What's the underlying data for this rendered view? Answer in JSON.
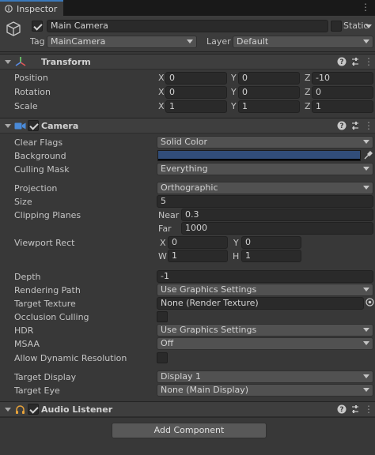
{
  "tab": {
    "label": "Inspector"
  },
  "object": {
    "name": "Main Camera",
    "static_label": "Static",
    "tag_label": "Tag",
    "tag_value": "MainCamera",
    "layer_label": "Layer",
    "layer_value": "Default"
  },
  "transform": {
    "title": "Transform",
    "position_label": "Position",
    "rotation_label": "Rotation",
    "scale_label": "Scale",
    "axes": {
      "x": "X",
      "y": "Y",
      "z": "Z"
    },
    "position": {
      "x": "0",
      "y": "0",
      "z": "-10"
    },
    "rotation": {
      "x": "0",
      "y": "0",
      "z": "0"
    },
    "scale": {
      "x": "1",
      "y": "1",
      "z": "1"
    }
  },
  "camera": {
    "title": "Camera",
    "clear_flags_label": "Clear Flags",
    "clear_flags_value": "Solid Color",
    "background_label": "Background",
    "background_color": "#314d79",
    "culling_mask_label": "Culling Mask",
    "culling_mask_value": "Everything",
    "projection_label": "Projection",
    "projection_value": "Orthographic",
    "size_label": "Size",
    "size_value": "5",
    "clipping_label": "Clipping Planes",
    "near_label": "Near",
    "near_value": "0.3",
    "far_label": "Far",
    "far_value": "1000",
    "viewport_label": "Viewport Rect",
    "vp_x_label": "X",
    "vp_x": "0",
    "vp_y_label": "Y",
    "vp_y": "0",
    "vp_w_label": "W",
    "vp_w": "1",
    "vp_h_label": "H",
    "vp_h": "1",
    "depth_label": "Depth",
    "depth_value": "-1",
    "rendering_path_label": "Rendering Path",
    "rendering_path_value": "Use Graphics Settings",
    "target_texture_label": "Target Texture",
    "target_texture_value": "None (Render Texture)",
    "occlusion_label": "Occlusion Culling",
    "hdr_label": "HDR",
    "hdr_value": "Use Graphics Settings",
    "msaa_label": "MSAA",
    "msaa_value": "Off",
    "dyn_res_label": "Allow Dynamic Resolution",
    "target_display_label": "Target Display",
    "target_display_value": "Display 1",
    "target_eye_label": "Target Eye",
    "target_eye_value": "None (Main Display)"
  },
  "audio": {
    "title": "Audio Listener"
  },
  "add_component_label": "Add Component",
  "colors": {
    "accent": "#3a79bb",
    "panel": "#383838",
    "field": "#2a2a2a"
  }
}
